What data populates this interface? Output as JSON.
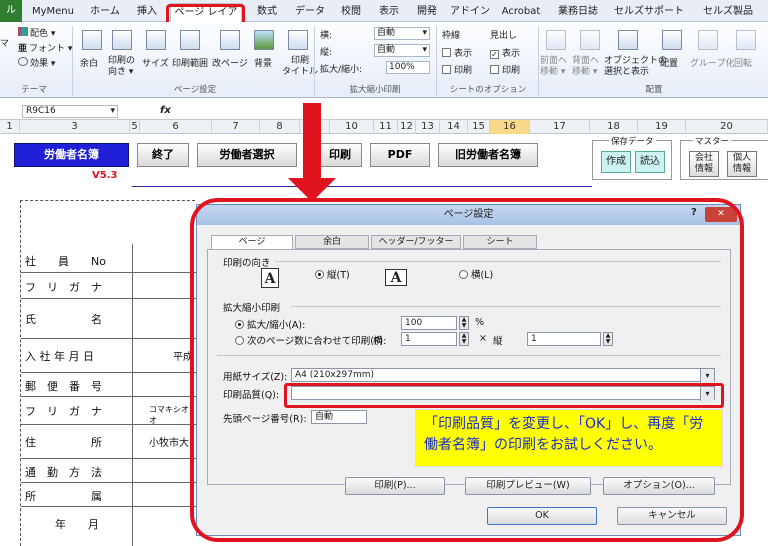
{
  "ribbon": {
    "tabs": [
      "ル",
      "MyMenu",
      "ホーム",
      "挿入",
      "ページ レイアウト",
      "数式",
      "データ",
      "校閲",
      "表示",
      "開発",
      "アドイン",
      "Acrobat",
      "業務日誌",
      "セルズサポート",
      "セルズ製品"
    ],
    "theme": {
      "colors": "配色 ▾",
      "fonts": "フォント ▾",
      "effects": "効果 ▾",
      "group": "テーマ",
      "left_mark": "マ"
    },
    "page_setup": {
      "margins": "余白",
      "orientation": "印刷の\n向き ▾",
      "size": "サイズ",
      "print_area": "印刷範囲",
      "breaks": "改ページ",
      "background": "背景",
      "print_titles": "印刷\nタイトル",
      "group": "ページ設定"
    },
    "scale": {
      "width_label": "横:",
      "width_value": "自動",
      "height_label": "縦:",
      "height_value": "自動",
      "scale_label": "拡大/縮小:",
      "scale_value": "100%",
      "group": "拡大縮小印刷"
    },
    "sheet_options": {
      "gridlines": "枠線",
      "headings": "見出し",
      "view": "表示",
      "print": "印刷",
      "group": "シートのオプション"
    },
    "arrange": {
      "forward": "前面へ\n移動 ▾",
      "backward": "背面へ\n移動 ▾",
      "selection": "オブジェクトの\n選択と表示",
      "align": "配置",
      "group_btn": "グループ化",
      "rotate": "回転",
      "group": "配置"
    }
  },
  "formula_bar": {
    "name_box": "R9C16",
    "fx": "fx"
  },
  "columns": [
    "1",
    "3",
    "5",
    "6",
    "7",
    "8",
    "",
    "10",
    "11",
    "12",
    "13",
    "14",
    "15",
    "16",
    "17",
    "18",
    "19",
    "20"
  ],
  "sheet": {
    "buttons": {
      "roster": "労働者名簿",
      "end": "終了",
      "select": "労働者選択",
      "print": "印刷",
      "pdf": "PDF",
      "old_roster": "旧労働者名簿"
    },
    "version": "V5.3",
    "save_data": {
      "title": "保存データ",
      "create": "作成",
      "read": "読込"
    },
    "master": {
      "title": "マスター",
      "company": "会社\n情報",
      "personal": "個人\n情報"
    },
    "form_rows": [
      {
        "label": "社　　員　　No",
        "value": ""
      },
      {
        "label": "フ　リ　ガ　ナ",
        "value": ""
      },
      {
        "label": "氏　　　　　名",
        "value": ""
      },
      {
        "label": "入 社 年 月 日",
        "value": "平成"
      },
      {
        "label": "郵　便　番　号",
        "value": ""
      },
      {
        "label": "フ　リ　ガ　ナ",
        "value": "コマキシオオ"
      },
      {
        "label": "住　　　　　所",
        "value": "小牧市大"
      },
      {
        "label": "通　勤　方　法",
        "value": ""
      },
      {
        "label": "所　　　　　属",
        "value": ""
      },
      {
        "label": "年　　月",
        "value": ""
      }
    ]
  },
  "dialog": {
    "title": "ページ設定",
    "help": "?",
    "close": "✕",
    "tabs": [
      "ページ",
      "余白",
      "ヘッダー/フッター",
      "シート"
    ],
    "orientation": {
      "label": "印刷の向き",
      "portrait": "縦(T)",
      "landscape": "横(L)"
    },
    "scaling": {
      "label": "拡大縮小印刷",
      "adjust": "拡大/縮小(A):",
      "adjust_value": "100",
      "percent": "%",
      "fit": "次のページ数に合わせて印刷(F):",
      "wide_label": "横",
      "wide_value": "1",
      "by": "×",
      "tall_label": "縦",
      "tall_value": "1"
    },
    "paper_size": {
      "label": "用紙サイズ(Z):",
      "value": "A4 (210x297mm)"
    },
    "print_quality": {
      "label": "印刷品質(Q):",
      "value": ""
    },
    "first_page": {
      "label": "先頭ページ番号(R):",
      "value": "自動"
    },
    "buttons": {
      "print": "印刷(P)...",
      "preview": "印刷プレビュー(W)",
      "options": "オプション(O)...",
      "ok": "OK",
      "cancel": "キャンセル"
    }
  },
  "callout": {
    "text": "「印刷品質」を変更し、「OK」し、再度「労働者名簿」の印刷をお試しください。"
  }
}
